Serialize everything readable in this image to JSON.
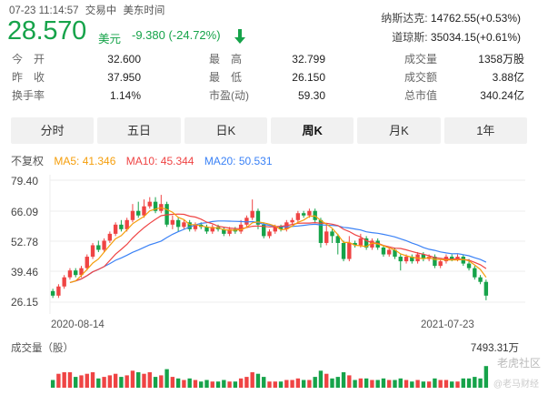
{
  "header": {
    "datetime": "07-23 11:14:57",
    "status": "交易中",
    "timezone": "美东时间",
    "price": "28.570",
    "currency": "美元",
    "change": "-9.380 (-24.72%)"
  },
  "indices": [
    {
      "name": "纳斯达克:",
      "value": "14762.55(+0.53%)"
    },
    {
      "name": "道琼斯:",
      "value": "35034.15(+0.61%)"
    }
  ],
  "stats": [
    {
      "label": "今　开",
      "value": "32.600"
    },
    {
      "label": "最　高",
      "value": "32.799"
    },
    {
      "label": "成交量",
      "value": "1358万股"
    },
    {
      "label": "昨　收",
      "value": "37.950"
    },
    {
      "label": "最　低",
      "value": "26.150"
    },
    {
      "label": "成交额",
      "value": "3.88亿"
    },
    {
      "label": "换手率",
      "value": "1.14%"
    },
    {
      "label": "市盈(动)",
      "value": "59.30"
    },
    {
      "label": "总市值",
      "value": "340.24亿"
    }
  ],
  "tabs": [
    "分时",
    "五日",
    "日K",
    "周K",
    "月K",
    "1年"
  ],
  "active_tab": "周K",
  "ma": {
    "adjust": "不复权",
    "ma5": "MA5: 41.346",
    "ma10": "MA10: 45.344",
    "ma20": "MA20: 50.531"
  },
  "colors": {
    "up": "#ef4444",
    "down": "#16a34a",
    "ma5": "#f59e0b",
    "ma10": "#ef4444",
    "ma20": "#3b82f6"
  },
  "y_labels": [
    "79.40",
    "66.09",
    "52.78",
    "39.46",
    "26.15"
  ],
  "x_labels": {
    "start": "2020-08-14",
    "end": "2021-07-23"
  },
  "volume": {
    "title": "成交量（股）",
    "max_label": "7493.31万"
  },
  "watermark": {
    "line1": "老虎社区",
    "line2": "@老马财经"
  },
  "chart_data": {
    "type": "candlestick",
    "ylim": [
      26.15,
      79.4
    ],
    "candles": [
      [
        31,
        29,
        32,
        28,
        0.25
      ],
      [
        29,
        33,
        34,
        28,
        0.45
      ],
      [
        33,
        37,
        38,
        32,
        0.5
      ],
      [
        37,
        40,
        41,
        36,
        0.5
      ],
      [
        40,
        38,
        41,
        37,
        0.35
      ],
      [
        38,
        41,
        42,
        37,
        0.4
      ],
      [
        41,
        46,
        47,
        40,
        0.45
      ],
      [
        46,
        51,
        52,
        45,
        0.5
      ],
      [
        51,
        49,
        53,
        48,
        0.3
      ],
      [
        49,
        53,
        54,
        48,
        0.35
      ],
      [
        53,
        56,
        57,
        52,
        0.4
      ],
      [
        56,
        60,
        61,
        55,
        0.45
      ],
      [
        60,
        58,
        62,
        57,
        0.35
      ],
      [
        58,
        62,
        63,
        57,
        0.4
      ],
      [
        62,
        66,
        69,
        61,
        0.55
      ],
      [
        66,
        64,
        70,
        63,
        0.5
      ],
      [
        64,
        68,
        71,
        63,
        0.45
      ],
      [
        68,
        70,
        72,
        67,
        0.5
      ],
      [
        70,
        66,
        72,
        65,
        0.35
      ],
      [
        66,
        69,
        73,
        65,
        0.4
      ],
      [
        69,
        60,
        70,
        59,
        0.6
      ],
      [
        60,
        62,
        64,
        58,
        0.35
      ],
      [
        62,
        59,
        63,
        57,
        0.3
      ],
      [
        59,
        61,
        62,
        58,
        0.25
      ],
      [
        61,
        58,
        62,
        57,
        0.3
      ],
      [
        58,
        60,
        61,
        57,
        0.25
      ],
      [
        60,
        59,
        61,
        58,
        0.2
      ],
      [
        59,
        57,
        60,
        56,
        0.25
      ],
      [
        57,
        59,
        60,
        56,
        0.2
      ],
      [
        59,
        58,
        60,
        57,
        0.2
      ],
      [
        58,
        56,
        59,
        55,
        0.25
      ],
      [
        56,
        58,
        59,
        55,
        0.2
      ],
      [
        58,
        57,
        59,
        56,
        0.2
      ],
      [
        57,
        60,
        62,
        56,
        0.3
      ],
      [
        60,
        63,
        64,
        59,
        0.35
      ],
      [
        63,
        66,
        71,
        62,
        0.5
      ],
      [
        66,
        60,
        67,
        58,
        0.45
      ],
      [
        60,
        55,
        61,
        54,
        0.35
      ],
      [
        55,
        57,
        58,
        54,
        0.2
      ],
      [
        57,
        59,
        60,
        56,
        0.2
      ],
      [
        59,
        58,
        60,
        57,
        0.2
      ],
      [
        58,
        61,
        62,
        57,
        0.25
      ],
      [
        61,
        62,
        63,
        60,
        0.25
      ],
      [
        62,
        65,
        66,
        61,
        0.3
      ],
      [
        65,
        64,
        66,
        63,
        0.25
      ],
      [
        64,
        66,
        67,
        63,
        0.25
      ],
      [
        66,
        62,
        67,
        61,
        0.35
      ],
      [
        62,
        52,
        63,
        50,
        0.55
      ],
      [
        52,
        57,
        60,
        51,
        0.45
      ],
      [
        57,
        55,
        58,
        52,
        0.3
      ],
      [
        55,
        52,
        56,
        47,
        0.35
      ],
      [
        52,
        45,
        53,
        44,
        0.5
      ],
      [
        45,
        52,
        55,
        44,
        0.4
      ],
      [
        52,
        51,
        53,
        50,
        0.25
      ],
      [
        51,
        54,
        56,
        50,
        0.3
      ],
      [
        54,
        50,
        55,
        49,
        0.3
      ],
      [
        50,
        53,
        54,
        49,
        0.25
      ],
      [
        53,
        50,
        54,
        49,
        0.25
      ],
      [
        50,
        47,
        51,
        46,
        0.3
      ],
      [
        47,
        49,
        50,
        46,
        0.25
      ],
      [
        49,
        46,
        50,
        45,
        0.25
      ],
      [
        46,
        44,
        47,
        40,
        0.3
      ],
      [
        44,
        46,
        47,
        43,
        0.25
      ],
      [
        46,
        44,
        47,
        43,
        0.2
      ],
      [
        44,
        47,
        48,
        43,
        0.25
      ],
      [
        47,
        45,
        48,
        44,
        0.2
      ],
      [
        45,
        46,
        47,
        44,
        0.2
      ],
      [
        46,
        42,
        47,
        41,
        0.3
      ],
      [
        42,
        44,
        45,
        41,
        0.25
      ],
      [
        44,
        46,
        47,
        43,
        0.25
      ],
      [
        46,
        45,
        47,
        44,
        0.2
      ],
      [
        45,
        46,
        47,
        44,
        0.2
      ],
      [
        46,
        43,
        47,
        42,
        0.3
      ],
      [
        43,
        41,
        45,
        40,
        0.3
      ],
      [
        41,
        37,
        42,
        36,
        0.35
      ],
      [
        37,
        35,
        38,
        34,
        0.3
      ],
      [
        35,
        29,
        36,
        27,
        0.7
      ]
    ]
  }
}
